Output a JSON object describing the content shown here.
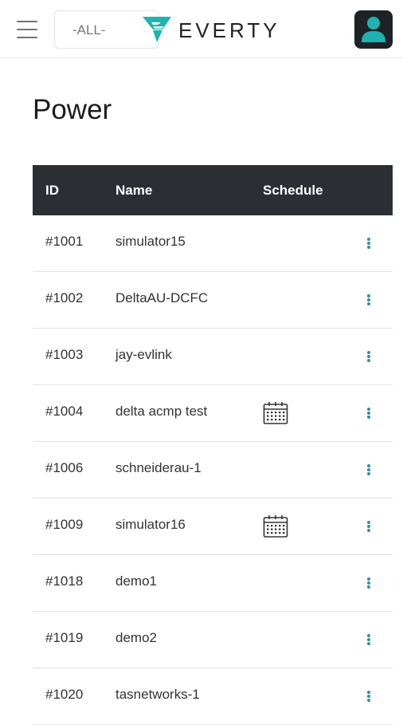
{
  "header": {
    "filter_value": "-ALL-",
    "logo_text": "EVERTY",
    "brand_color": "#1fb3b0"
  },
  "page": {
    "title": "Power"
  },
  "table": {
    "columns": [
      "ID",
      "Name",
      "Schedule"
    ],
    "rows": [
      {
        "id": "#1001",
        "name": "simulator15",
        "scheduled": false
      },
      {
        "id": "#1002",
        "name": "DeltaAU-DCFC",
        "scheduled": false
      },
      {
        "id": "#1003",
        "name": "jay-evlink",
        "scheduled": false
      },
      {
        "id": "#1004",
        "name": "delta acmp test",
        "scheduled": true
      },
      {
        "id": "#1006",
        "name": "schneiderau-1",
        "scheduled": false
      },
      {
        "id": "#1009",
        "name": "simulator16",
        "scheduled": true
      },
      {
        "id": "#1018",
        "name": "demo1",
        "scheduled": false
      },
      {
        "id": "#1019",
        "name": "demo2",
        "scheduled": false
      },
      {
        "id": "#1020",
        "name": "tasnetworks-1",
        "scheduled": false
      }
    ]
  },
  "icons": {
    "menu": "hamburger-menu-icon",
    "schedule": "calendar-icon",
    "row_actions": "more-vertical-icon",
    "account": "user-icon"
  }
}
